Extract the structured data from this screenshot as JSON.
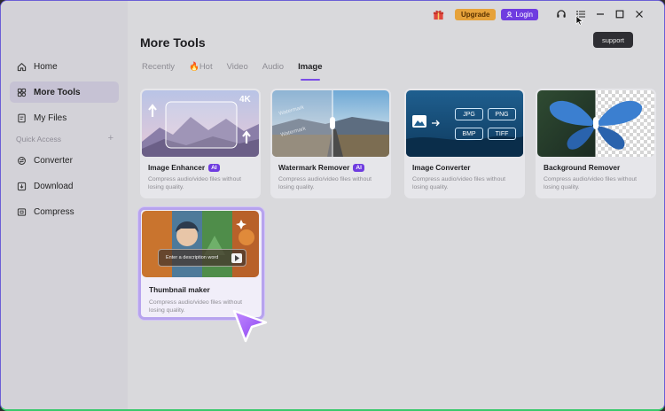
{
  "sidebar": {
    "items": [
      {
        "label": "Home",
        "icon": "home-icon"
      },
      {
        "label": "More Tools",
        "icon": "tools-icon",
        "active": true
      },
      {
        "label": "My Files",
        "icon": "file-icon"
      }
    ],
    "section_label": "Quick Access",
    "section_add": "+",
    "quick_items": [
      {
        "label": "Converter",
        "icon": "converter-icon"
      },
      {
        "label": "Download",
        "icon": "download-icon"
      },
      {
        "label": "Compress",
        "icon": "compress-icon"
      }
    ]
  },
  "topbar": {
    "upgrade_label": "Upgrade",
    "login_label": "Login",
    "tooltip": "support"
  },
  "main": {
    "title": "More Tools",
    "tabs": [
      {
        "label": "Recently"
      },
      {
        "label": "Hot",
        "prefix": "🔥"
      },
      {
        "label": "Video"
      },
      {
        "label": "Audio"
      },
      {
        "label": "Image",
        "active": true
      }
    ],
    "cards": [
      {
        "title": "Image Enhancer",
        "ai": "AI",
        "badge": "4K",
        "desc": "Compress audio/video files without losing quality."
      },
      {
        "title": "Watermark Remover",
        "ai": "AI",
        "desc": "Compress audio/video files without losing quality."
      },
      {
        "title": "Image Converter",
        "desc": "Compress audio/video files without losing quality.",
        "formats": [
          "JPG",
          "PNG",
          "BMP",
          "TIFF"
        ]
      },
      {
        "title": "Background Remover",
        "desc": "Compress audio/video files without losing quality."
      },
      {
        "title": "Thumbnail maker",
        "desc": "Compress audio/video files without losing quality.",
        "input_placeholder": "Enter a description word"
      }
    ]
  },
  "colors": {
    "accent": "#6f3ce0",
    "upgrade": "#e6a23a",
    "sidebar_bg": "#d3d2d8",
    "main_bg": "#d9d9dc"
  }
}
